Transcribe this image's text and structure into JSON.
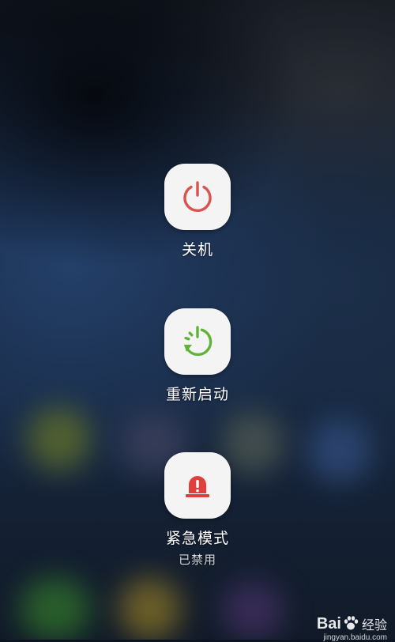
{
  "power_menu": {
    "power_off": {
      "label": "关机",
      "icon": "power-icon",
      "color": "#d9534f"
    },
    "restart": {
      "label": "重新启动",
      "icon": "restart-icon",
      "color": "#5fb336"
    },
    "emergency": {
      "label": "紧急模式",
      "sublabel": "已禁用",
      "icon": "emergency-siren-icon",
      "color": "#e0403c"
    }
  },
  "watermark": {
    "brand_left": "Bai",
    "brand_right": "经验",
    "url": "jingyan.baidu.com"
  }
}
